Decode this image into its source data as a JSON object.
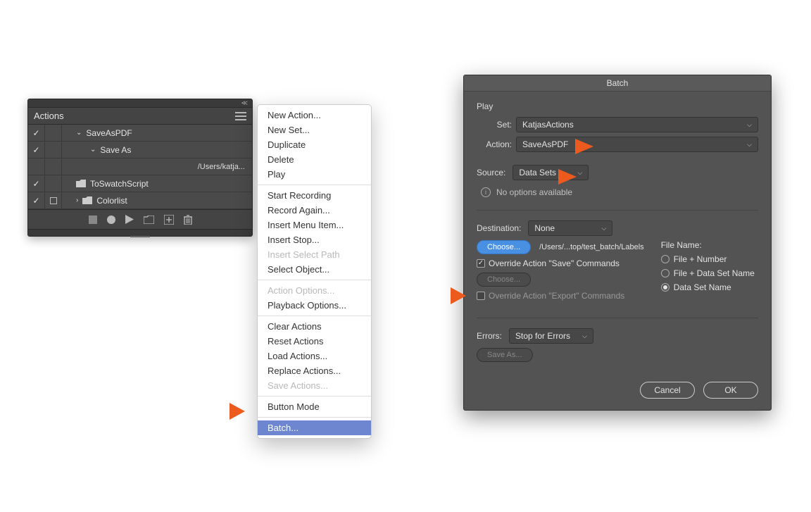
{
  "actions_panel": {
    "title": "Actions",
    "rows": [
      {
        "checked": true,
        "indent": 0,
        "chev": "v",
        "label": "SaveAsPDF"
      },
      {
        "checked": true,
        "indent": 1,
        "chev": "v",
        "label": "Save As"
      },
      {
        "checked": false,
        "indent": 3,
        "path": "/Users/katja..."
      },
      {
        "checked": true,
        "indent": 0,
        "folder": true,
        "label": "ToSwatchScript"
      },
      {
        "checked": true,
        "stopbox": true,
        "indent": 0,
        "chev": ">",
        "folder": true,
        "label": "Colorlist"
      }
    ]
  },
  "ctx": {
    "groups": [
      [
        {
          "label": "New Action..."
        },
        {
          "label": "New Set..."
        },
        {
          "label": "Duplicate"
        },
        {
          "label": "Delete"
        },
        {
          "label": "Play"
        }
      ],
      [
        {
          "label": "Start Recording"
        },
        {
          "label": "Record Again..."
        },
        {
          "label": "Insert Menu Item..."
        },
        {
          "label": "Insert Stop..."
        },
        {
          "label": "Insert Select Path",
          "disabled": true
        },
        {
          "label": "Select Object..."
        }
      ],
      [
        {
          "label": "Action Options...",
          "disabled": true
        },
        {
          "label": "Playback Options..."
        }
      ],
      [
        {
          "label": "Clear Actions"
        },
        {
          "label": "Reset Actions"
        },
        {
          "label": "Load Actions..."
        },
        {
          "label": "Replace Actions..."
        },
        {
          "label": "Save Actions...",
          "disabled": true
        }
      ],
      [
        {
          "label": "Button Mode"
        }
      ],
      [
        {
          "label": "Batch...",
          "hover": true
        }
      ]
    ]
  },
  "batch": {
    "title": "Batch",
    "play_label": "Play",
    "set_label": "Set:",
    "set_value": "KatjasActions",
    "action_label": "Action:",
    "action_value": "SaveAsPDF",
    "source_label": "Source:",
    "source_value": "Data Sets",
    "no_options": "No options available",
    "dest_label": "Destination:",
    "dest_value": "None",
    "choose_btn": "Choose...",
    "dest_path": "/Users/...top/test_batch/Labels",
    "override_save": "Override Action \"Save\" Commands",
    "disabled_choose": "Choose...",
    "override_export": "Override Action \"Export\" Commands",
    "filename_label": "File Name:",
    "filename_options": [
      {
        "label": "File + Number",
        "selected": false
      },
      {
        "label": "File + Data Set Name",
        "selected": false
      },
      {
        "label": "Data Set Name",
        "selected": true
      }
    ],
    "errors_label": "Errors:",
    "errors_value": "Stop for Errors",
    "saveas_btn": "Save As...",
    "cancel": "Cancel",
    "ok": "OK"
  }
}
